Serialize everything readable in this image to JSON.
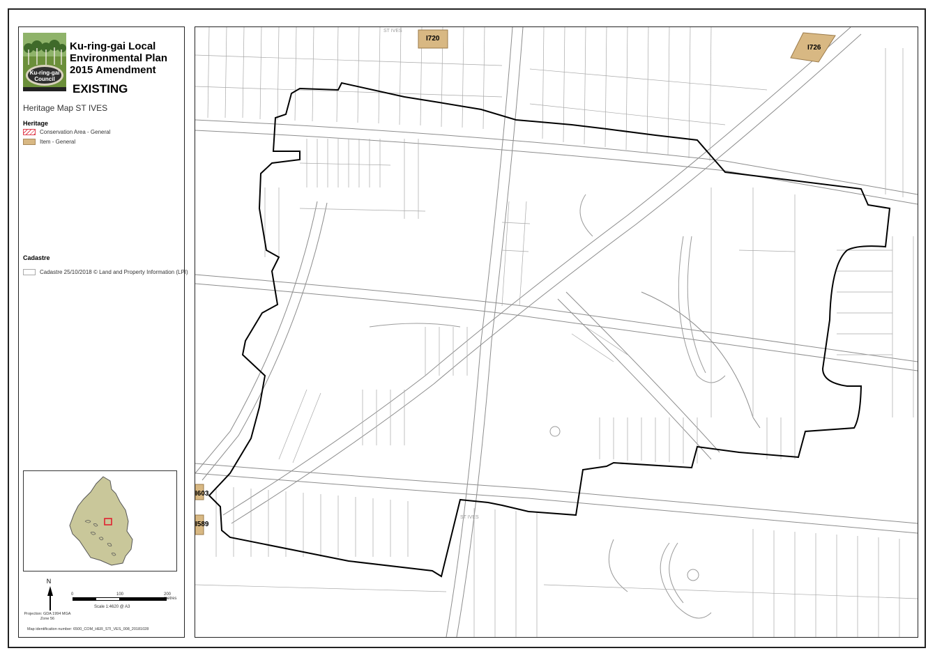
{
  "title": {
    "line1": "Ku-ring-gai Local",
    "line2": "Environmental Plan",
    "line3": "2015 Amendment",
    "status": "EXISTING"
  },
  "logo": {
    "text": "Ku-ring-gai Council",
    "colors": {
      "green": "#6b8f3a",
      "dark": "#2f2f2f"
    }
  },
  "map_title": "Heritage Map ST IVES",
  "legend": {
    "heritage_heading": "Heritage",
    "heritage_items": [
      {
        "label": "Conservation Area - General",
        "color": "#e0404f"
      },
      {
        "label": "Item - General",
        "color": "#d8b883"
      }
    ],
    "cadastre_heading": "Cadastre",
    "cadastre_items": [
      {
        "label": "Cadastre 25/10/2018 © Land and Property Information (LPI)"
      }
    ]
  },
  "north": "N",
  "projection": "Projection: GDA 1994 MGA Zone 56",
  "scale": {
    "ticks": [
      "0",
      "100",
      "200 metres"
    ],
    "text": "Scale    1:4620    @ A3"
  },
  "map_id": "Map identification number:    6500_COM_HER_STI_VES_008_20181028",
  "heritage_items": [
    "I720",
    "I726",
    "I603",
    "I589"
  ],
  "street_labels": [
    "ST IVES",
    "ST IVES"
  ],
  "colors": {
    "item_fill": "#d8b883",
    "boundary": "#000000",
    "cadastre": "#9a9a9a"
  }
}
